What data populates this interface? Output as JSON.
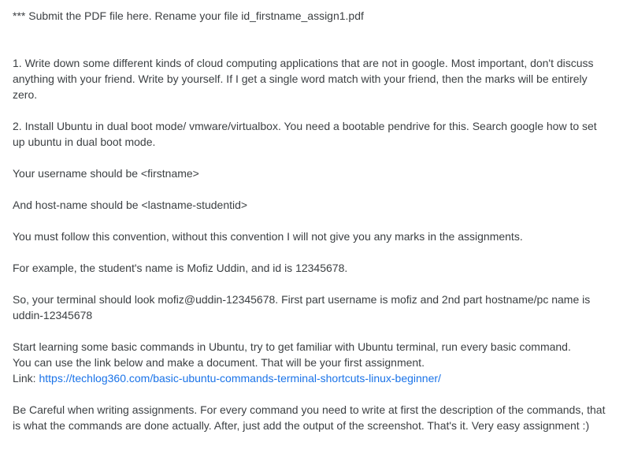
{
  "post": {
    "intro": "*** Submit the PDF file here. Rename your file id_firstname_assign1.pdf",
    "item1": "1. Write down some different kinds of cloud computing applications that are not in google. Most important, don't discuss anything with your friend. Write by yourself. If I get a single word match with your friend, then the marks will be entirely zero.",
    "item2": "2. Install Ubuntu in dual boot mode/ vmware/virtualbox. You need a bootable pendrive for this. Search google how to set up ubuntu in dual boot mode.",
    "username": "Your username should be <firstname>",
    "hostname": "And host-name should be <lastname-studentid>",
    "convention": "You must follow this convention, without this convention I will not give you any marks in the assignments.",
    "example": "For example, the student's name is Mofiz Uddin, and id is 12345678.",
    "terminal": "So, your terminal should look mofiz@uddin-12345678. First part username is mofiz and 2nd part hostname/pc name is uddin-12345678",
    "learning": {
      "line1": "Start learning some basic commands in Ubuntu, try to get familiar with Ubuntu terminal, run every basic command.",
      "line2": "You can use the link below and make a document. That will be your first assignment.",
      "link_label": "Link: ",
      "link_text": "https://techlog360.com/basic-ubuntu-commands-terminal-shortcuts-linux-beginner/"
    },
    "careful": "Be Careful when writing assignments. For every command you need to write at first the description of the commands, that is what the commands are done actually. After, just add the output of the screenshot. That's it. Very easy assignment :)"
  },
  "colors": {
    "text": "#3c4043",
    "link": "#1a73e8"
  }
}
